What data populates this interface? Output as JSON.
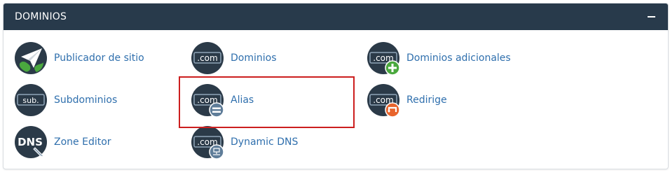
{
  "panel": {
    "title": "DOMINIOS",
    "collapse_icon": "minus-icon"
  },
  "items": [
    {
      "label": "Publicador de sitio",
      "icon": "paper-plane-globe-icon"
    },
    {
      "label": "Dominios",
      "icon": "dot-com-icon"
    },
    {
      "label": "Dominios adicionales",
      "icon": "dot-com-plus-icon"
    },
    {
      "label": "Subdominios",
      "icon": "sub-icon"
    },
    {
      "label": "Alias",
      "icon": "dot-com-equals-icon"
    },
    {
      "label": "Redirige",
      "icon": "dot-com-redirect-icon"
    },
    {
      "label": "Zone Editor",
      "icon": "dns-pencil-icon"
    },
    {
      "label": "Dynamic DNS",
      "icon": "dot-com-network-icon"
    }
  ],
  "icon_text": {
    "com": ".com",
    "sub": "sub.",
    "dns": "DNS"
  },
  "colors": {
    "header_bg": "#283a4b",
    "link": "#2f6fad",
    "icon_dark": "#2b3a48",
    "plus_green": "#4aa83e",
    "redirect_orange": "#e8642c",
    "highlight_red": "#cc1f1f"
  }
}
